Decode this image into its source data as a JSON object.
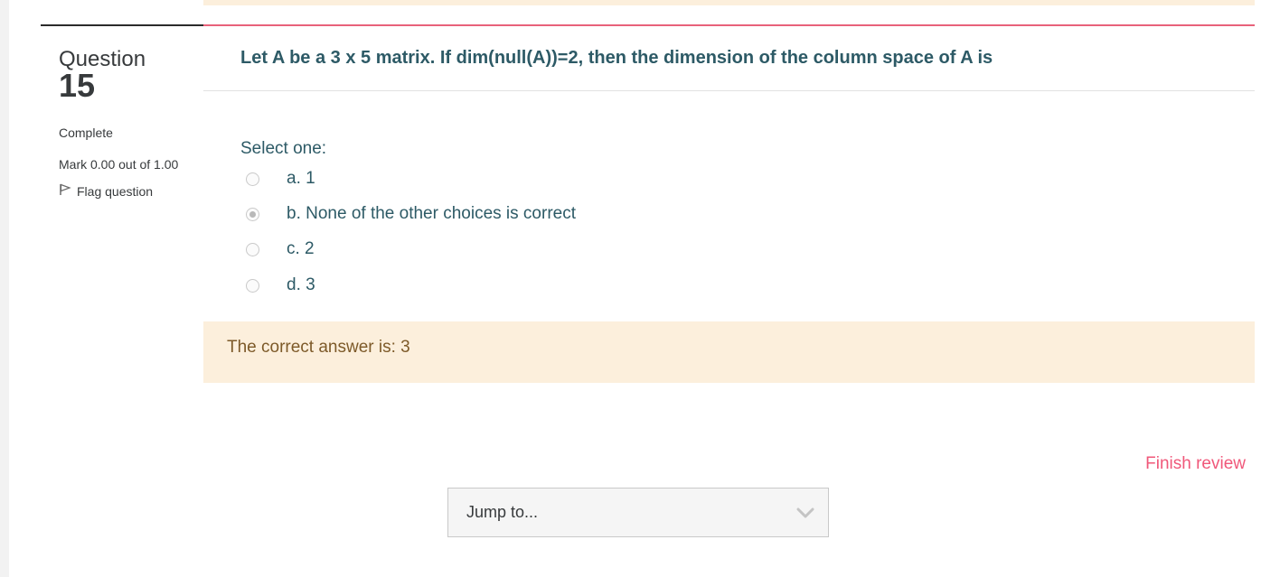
{
  "question_info": {
    "word": "Question",
    "number": "15",
    "state": "Complete",
    "grade": "Mark 0.00 out of 1.00",
    "flag_label": "Flag question"
  },
  "question": {
    "text": "Let A be a 3 x 5 matrix. If dim(null(A))=2, then the dimension of the column space of A is",
    "prompt": "Select one:",
    "answers": [
      {
        "label": "a. 1",
        "selected": false
      },
      {
        "label": "b. None of the other choices is correct",
        "selected": true
      },
      {
        "label": "c. 2",
        "selected": false
      },
      {
        "label": "d. 3",
        "selected": false
      }
    ]
  },
  "feedback": {
    "correct_answer": "The correct answer is: 3"
  },
  "navigation": {
    "finish_review": "Finish review",
    "jump_placeholder": "Jump to..."
  },
  "colors": {
    "question_text": "#2d5a66",
    "feedback_bg": "#fcefdc",
    "feedback_text": "#7d5a29",
    "accent_link": "#f0587a",
    "top_accent": "#e8627a"
  },
  "icons": {
    "flag": "flag-icon",
    "dropdown": "chevron-down-icon"
  }
}
